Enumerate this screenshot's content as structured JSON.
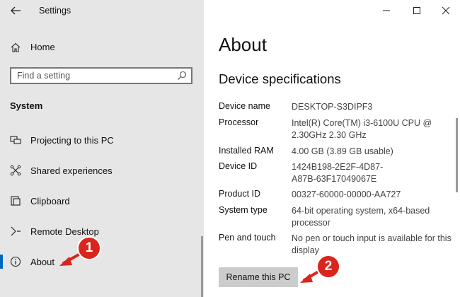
{
  "window": {
    "title": "Settings",
    "controls": {
      "minimize_icon": "minimize-icon",
      "maximize_icon": "maximize-icon",
      "close_icon": "close-icon"
    }
  },
  "sidebar": {
    "home_label": "Home",
    "search_placeholder": "Find a setting",
    "section_title": "System",
    "items": [
      {
        "label": "Projecting to this PC",
        "icon": "projector-icon"
      },
      {
        "label": "Shared experiences",
        "icon": "shared-experiences-icon"
      },
      {
        "label": "Clipboard",
        "icon": "clipboard-icon"
      },
      {
        "label": "Remote Desktop",
        "icon": "remote-desktop-icon"
      },
      {
        "label": "About",
        "icon": "info-icon",
        "selected": true
      }
    ]
  },
  "main": {
    "title": "About",
    "subheading": "Device specifications",
    "specs": [
      {
        "label": "Device name",
        "value": "DESKTOP-S3DIPF3"
      },
      {
        "label": "Processor",
        "value": "Intel(R) Core(TM) i3-6100U CPU @ 2.30GHz   2.30 GHz"
      },
      {
        "label": "Installed RAM",
        "value": "4.00 GB (3.89 GB usable)"
      },
      {
        "label": "Device ID",
        "value": "1424B198-2E2F-4D87-A87B-63F17049067E"
      },
      {
        "label": "Product ID",
        "value": "00327-60000-00000-AA727"
      },
      {
        "label": "System type",
        "value": "64-bit operating system, x64-based processor"
      },
      {
        "label": "Pen and touch",
        "value": "No pen or touch input is available for this display"
      }
    ],
    "rename_button": "Rename this PC"
  },
  "annotations": {
    "badge_1": "1",
    "badge_2": "2",
    "accent_color": "#d9261c"
  },
  "colors": {
    "sidebar_bg": "#e6e6e6",
    "selection_accent": "#0067c0",
    "button_bg": "#cccccc"
  }
}
